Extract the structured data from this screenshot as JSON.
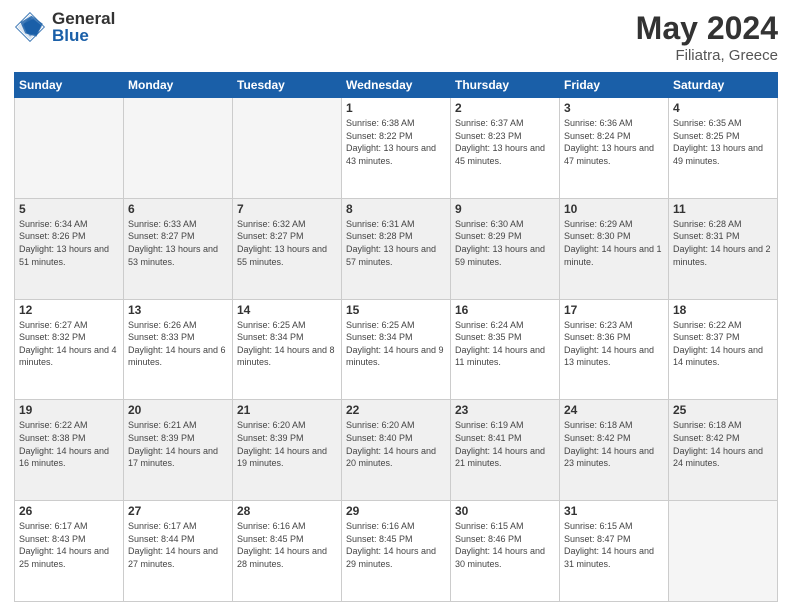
{
  "logo": {
    "general": "General",
    "blue": "Blue"
  },
  "title": {
    "month": "May 2024",
    "location": "Filiatra, Greece"
  },
  "weekdays": [
    "Sunday",
    "Monday",
    "Tuesday",
    "Wednesday",
    "Thursday",
    "Friday",
    "Saturday"
  ],
  "weeks": [
    [
      {
        "day": "",
        "empty": true
      },
      {
        "day": "",
        "empty": true
      },
      {
        "day": "",
        "empty": true
      },
      {
        "day": "1",
        "sunrise": "6:38 AM",
        "sunset": "8:22 PM",
        "daylight": "13 hours and 43 minutes."
      },
      {
        "day": "2",
        "sunrise": "6:37 AM",
        "sunset": "8:23 PM",
        "daylight": "13 hours and 45 minutes."
      },
      {
        "day": "3",
        "sunrise": "6:36 AM",
        "sunset": "8:24 PM",
        "daylight": "13 hours and 47 minutes."
      },
      {
        "day": "4",
        "sunrise": "6:35 AM",
        "sunset": "8:25 PM",
        "daylight": "13 hours and 49 minutes."
      }
    ],
    [
      {
        "day": "5",
        "sunrise": "6:34 AM",
        "sunset": "8:26 PM",
        "daylight": "13 hours and 51 minutes."
      },
      {
        "day": "6",
        "sunrise": "6:33 AM",
        "sunset": "8:27 PM",
        "daylight": "13 hours and 53 minutes."
      },
      {
        "day": "7",
        "sunrise": "6:32 AM",
        "sunset": "8:27 PM",
        "daylight": "13 hours and 55 minutes."
      },
      {
        "day": "8",
        "sunrise": "6:31 AM",
        "sunset": "8:28 PM",
        "daylight": "13 hours and 57 minutes."
      },
      {
        "day": "9",
        "sunrise": "6:30 AM",
        "sunset": "8:29 PM",
        "daylight": "13 hours and 59 minutes."
      },
      {
        "day": "10",
        "sunrise": "6:29 AM",
        "sunset": "8:30 PM",
        "daylight": "14 hours and 1 minute."
      },
      {
        "day": "11",
        "sunrise": "6:28 AM",
        "sunset": "8:31 PM",
        "daylight": "14 hours and 2 minutes."
      }
    ],
    [
      {
        "day": "12",
        "sunrise": "6:27 AM",
        "sunset": "8:32 PM",
        "daylight": "14 hours and 4 minutes."
      },
      {
        "day": "13",
        "sunrise": "6:26 AM",
        "sunset": "8:33 PM",
        "daylight": "14 hours and 6 minutes."
      },
      {
        "day": "14",
        "sunrise": "6:25 AM",
        "sunset": "8:34 PM",
        "daylight": "14 hours and 8 minutes."
      },
      {
        "day": "15",
        "sunrise": "6:25 AM",
        "sunset": "8:34 PM",
        "daylight": "14 hours and 9 minutes."
      },
      {
        "day": "16",
        "sunrise": "6:24 AM",
        "sunset": "8:35 PM",
        "daylight": "14 hours and 11 minutes."
      },
      {
        "day": "17",
        "sunrise": "6:23 AM",
        "sunset": "8:36 PM",
        "daylight": "14 hours and 13 minutes."
      },
      {
        "day": "18",
        "sunrise": "6:22 AM",
        "sunset": "8:37 PM",
        "daylight": "14 hours and 14 minutes."
      }
    ],
    [
      {
        "day": "19",
        "sunrise": "6:22 AM",
        "sunset": "8:38 PM",
        "daylight": "14 hours and 16 minutes."
      },
      {
        "day": "20",
        "sunrise": "6:21 AM",
        "sunset": "8:39 PM",
        "daylight": "14 hours and 17 minutes."
      },
      {
        "day": "21",
        "sunrise": "6:20 AM",
        "sunset": "8:39 PM",
        "daylight": "14 hours and 19 minutes."
      },
      {
        "day": "22",
        "sunrise": "6:20 AM",
        "sunset": "8:40 PM",
        "daylight": "14 hours and 20 minutes."
      },
      {
        "day": "23",
        "sunrise": "6:19 AM",
        "sunset": "8:41 PM",
        "daylight": "14 hours and 21 minutes."
      },
      {
        "day": "24",
        "sunrise": "6:18 AM",
        "sunset": "8:42 PM",
        "daylight": "14 hours and 23 minutes."
      },
      {
        "day": "25",
        "sunrise": "6:18 AM",
        "sunset": "8:42 PM",
        "daylight": "14 hours and 24 minutes."
      }
    ],
    [
      {
        "day": "26",
        "sunrise": "6:17 AM",
        "sunset": "8:43 PM",
        "daylight": "14 hours and 25 minutes."
      },
      {
        "day": "27",
        "sunrise": "6:17 AM",
        "sunset": "8:44 PM",
        "daylight": "14 hours and 27 minutes."
      },
      {
        "day": "28",
        "sunrise": "6:16 AM",
        "sunset": "8:45 PM",
        "daylight": "14 hours and 28 minutes."
      },
      {
        "day": "29",
        "sunrise": "6:16 AM",
        "sunset": "8:45 PM",
        "daylight": "14 hours and 29 minutes."
      },
      {
        "day": "30",
        "sunrise": "6:15 AM",
        "sunset": "8:46 PM",
        "daylight": "14 hours and 30 minutes."
      },
      {
        "day": "31",
        "sunrise": "6:15 AM",
        "sunset": "8:47 PM",
        "daylight": "14 hours and 31 minutes."
      },
      {
        "day": "",
        "empty": true
      }
    ]
  ]
}
